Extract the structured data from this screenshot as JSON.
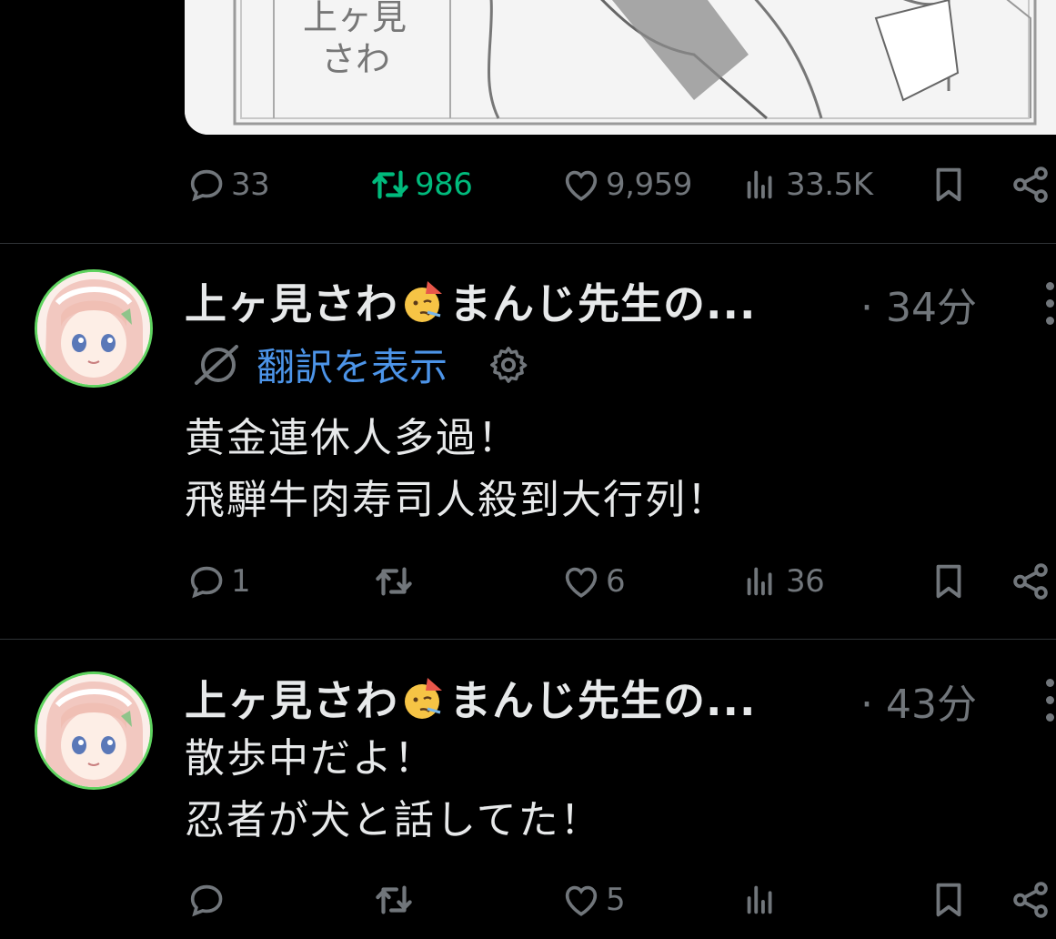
{
  "colors": {
    "background": "#000000",
    "text": "#e7e9ea",
    "muted": "#71767b",
    "link": "#4c94e8",
    "retweet_active": "#00ba7c",
    "divider": "#2f3336"
  },
  "top_post": {
    "media_text": "上ヶ見\nさわ",
    "actions": {
      "replies": "33",
      "reposts": "986",
      "likes": "9,959",
      "views": "33.5K"
    }
  },
  "posts": [
    {
      "author": "上ヶ見さわ",
      "author_suffix": "まんじ先生の...",
      "separator": "·",
      "time": "34分",
      "translate_label": "翻訳を表示",
      "text_line1": "黄金連休人多過！",
      "text_line2": "飛騨牛肉寿司人殺到大行列！",
      "actions": {
        "replies": "1",
        "reposts": "",
        "likes": "6",
        "views": "36"
      }
    },
    {
      "author": "上ヶ見さわ",
      "author_suffix": "まんじ先生の...",
      "separator": "·",
      "time": "43分",
      "text_line1": "散歩中だよ！",
      "text_line2": "忍者が犬と話してた！",
      "actions": {
        "replies": "",
        "reposts": "",
        "likes": "5",
        "views": ""
      }
    }
  ],
  "icons": [
    "reply-icon",
    "repost-icon",
    "like-icon",
    "views-icon",
    "bookmark-icon",
    "share-icon",
    "more-icon",
    "translate-icon",
    "gear-icon",
    "party-emoji"
  ]
}
